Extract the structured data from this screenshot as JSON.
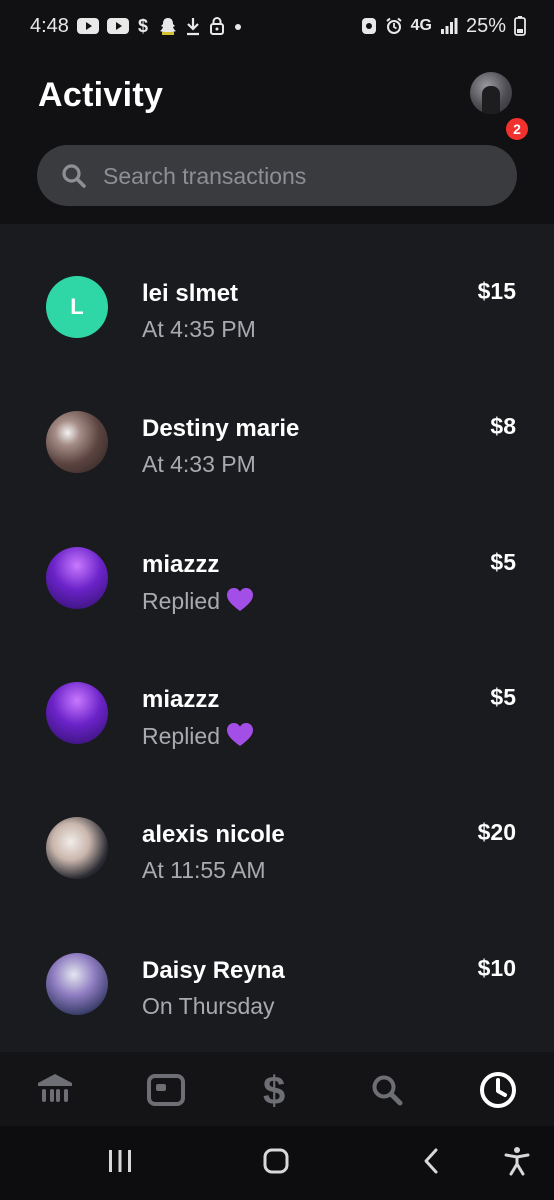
{
  "status_bar": {
    "time": "4:48",
    "network": "4G",
    "battery": "25%"
  },
  "header": {
    "title": "Activity",
    "notification_count": "2"
  },
  "search": {
    "placeholder": "Search transactions"
  },
  "transactions": [
    {
      "name": "lei slmet",
      "subtitle": "At 4:35 PM",
      "amount": "$15",
      "avatar_letter": "L"
    },
    {
      "name": "Destiny marie",
      "subtitle": "At 4:33 PM",
      "amount": "$8"
    },
    {
      "name": "miazzz",
      "subtitle": "Replied",
      "amount": "$5",
      "reaction": "purple-heart-icon"
    },
    {
      "name": "miazzz",
      "subtitle": "Replied",
      "amount": "$5",
      "reaction": "purple-heart-icon"
    },
    {
      "name": "alexis nicole",
      "subtitle": "At 11:55 AM",
      "amount": "$20"
    },
    {
      "name": "Daisy Reyna",
      "subtitle": "On Thursday",
      "amount": "$10"
    }
  ],
  "tab_bar": {
    "items": [
      "bank-icon",
      "card-icon",
      "dollar-icon",
      "search-icon",
      "activity-clock-icon"
    ],
    "active": "activity-clock-icon"
  },
  "colors": {
    "background": "#1a1b1e",
    "header_background": "#111113",
    "accent_green": "#2fd7a6",
    "badge_red": "#f0312d",
    "subtext": "#a9aaaf"
  }
}
